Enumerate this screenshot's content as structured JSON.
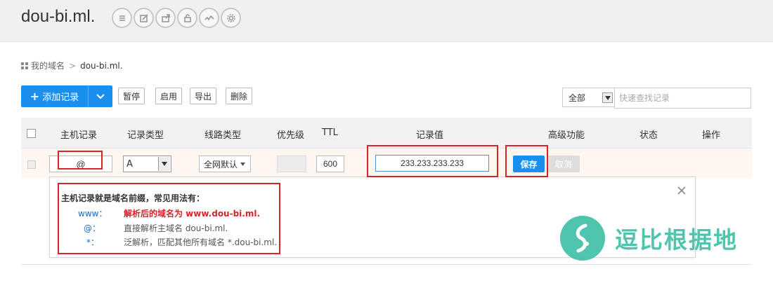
{
  "header": {
    "domain": "dou-bi.ml.",
    "icons": [
      "list-icon",
      "edit-icon",
      "share-icon",
      "lock-icon",
      "chart-icon",
      "gear-icon"
    ]
  },
  "breadcrumb": {
    "root": "我的域名",
    "current": "dou-bi.ml."
  },
  "toolbar": {
    "add_label": "添加记录",
    "pause_label": "暂停",
    "enable_label": "启用",
    "export_label": "导出",
    "delete_label": "删除",
    "filter_value": "全部",
    "search_placeholder": "快速查找记录"
  },
  "table": {
    "headers": {
      "host": "主机记录",
      "type": "记录类型",
      "line": "线路类型",
      "priority": "优先级",
      "ttl": "TTL",
      "value": "记录值",
      "advanced": "高级功能",
      "status": "状态",
      "actions": "操作"
    }
  },
  "edit_row": {
    "host": "@",
    "type": "A",
    "line": "全网默认",
    "ttl": "600",
    "value": "233.233.233.233",
    "save_label": "保存",
    "cancel_label": "取消"
  },
  "tip": {
    "title": "主机记录就是域名前缀，常见用法有：",
    "items": [
      {
        "key": "www：",
        "desc": "解析后的域名为 www.dou-bi.ml."
      },
      {
        "key": "@：",
        "desc": "直接解析主域名 dou-bi.ml."
      },
      {
        "key": "*：",
        "desc": "泛解析，匹配其他所有域名 *.dou-bi.ml."
      }
    ]
  },
  "watermark": {
    "text": "逗比根据地"
  },
  "colors": {
    "primary": "#1a8ff0",
    "highlight": "#d8232a",
    "watermark": "#3dbfa6"
  }
}
